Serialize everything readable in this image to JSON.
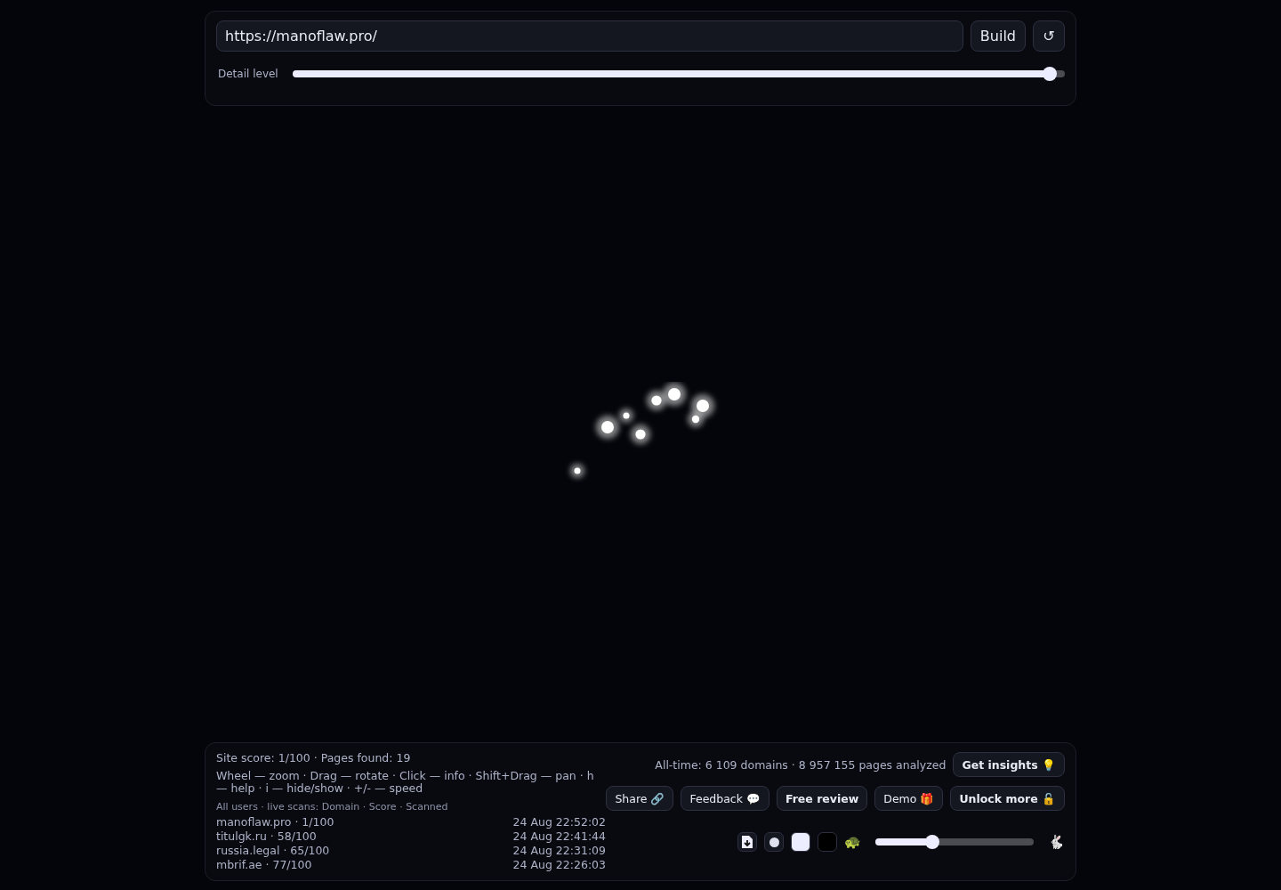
{
  "url_field": {
    "value": "https://manoflaw.pro/"
  },
  "build_button": "Build",
  "reset_button": "↺",
  "detail": {
    "label": "Detail level",
    "level": 0.98
  },
  "bottom": {
    "summary": "Site score: 1/100 · Pages found: 19",
    "help": "Wheel — zoom · Drag — rotate · Click — info · Shift+Drag — pan · h — help · i — hide/show · +/- — speed",
    "scans_heading": "All users · live scans: Domain · Score · Scanned",
    "scans": [
      {
        "domain": "manoflaw.pro · 1/100",
        "time": "24 Aug 22:52:02"
      },
      {
        "domain": "titulgk.ru · 58/100",
        "time": "24 Aug 22:41:44"
      },
      {
        "domain": "russia.legal · 65/100",
        "time": "24 Aug 22:31:09"
      },
      {
        "domain": "mbrif.ae · 77/100",
        "time": "24 Aug 22:26:03"
      }
    ],
    "stats": "All-time: 6 109 domains · 8 957 155 pages analyzed",
    "insights_button": "Get insights 💡",
    "buttons": [
      {
        "label": "Share 🔗",
        "bold": false
      },
      {
        "label": "Feedback 💬",
        "bold": false
      },
      {
        "label": "Free review",
        "bold": true
      },
      {
        "label": "Demo 🎁",
        "bold": false
      },
      {
        "label": "Unlock more 🔓",
        "bold": true
      }
    ],
    "speed": {
      "slow": "🐢",
      "fast": "🐇",
      "level": 0.36
    }
  }
}
